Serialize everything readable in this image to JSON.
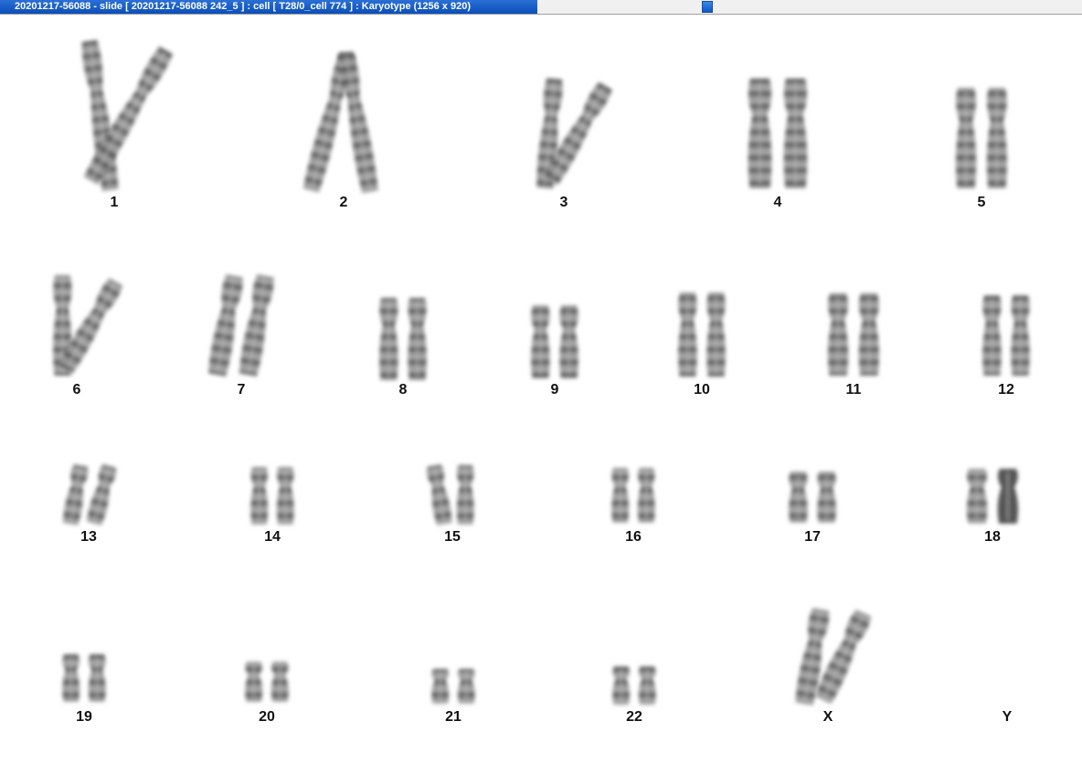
{
  "window": {
    "title": "20201217-56088 - slide [ 20201217-56088 242_5 ] : cell [ T28/0_cell 774 ] : Karyotype  (1256 x 920)"
  },
  "karyotype": {
    "chromosomes": [
      {
        "label": "1"
      },
      {
        "label": "2"
      },
      {
        "label": "3"
      },
      {
        "label": "4"
      },
      {
        "label": "5"
      },
      {
        "label": "6"
      },
      {
        "label": "7"
      },
      {
        "label": "8"
      },
      {
        "label": "9"
      },
      {
        "label": "10"
      },
      {
        "label": "11"
      },
      {
        "label": "12"
      },
      {
        "label": "13"
      },
      {
        "label": "14"
      },
      {
        "label": "15"
      },
      {
        "label": "16"
      },
      {
        "label": "17"
      },
      {
        "label": "18"
      },
      {
        "label": "19"
      },
      {
        "label": "20"
      },
      {
        "label": "21"
      },
      {
        "label": "22"
      },
      {
        "label": "X"
      },
      {
        "label": "Y"
      }
    ]
  }
}
